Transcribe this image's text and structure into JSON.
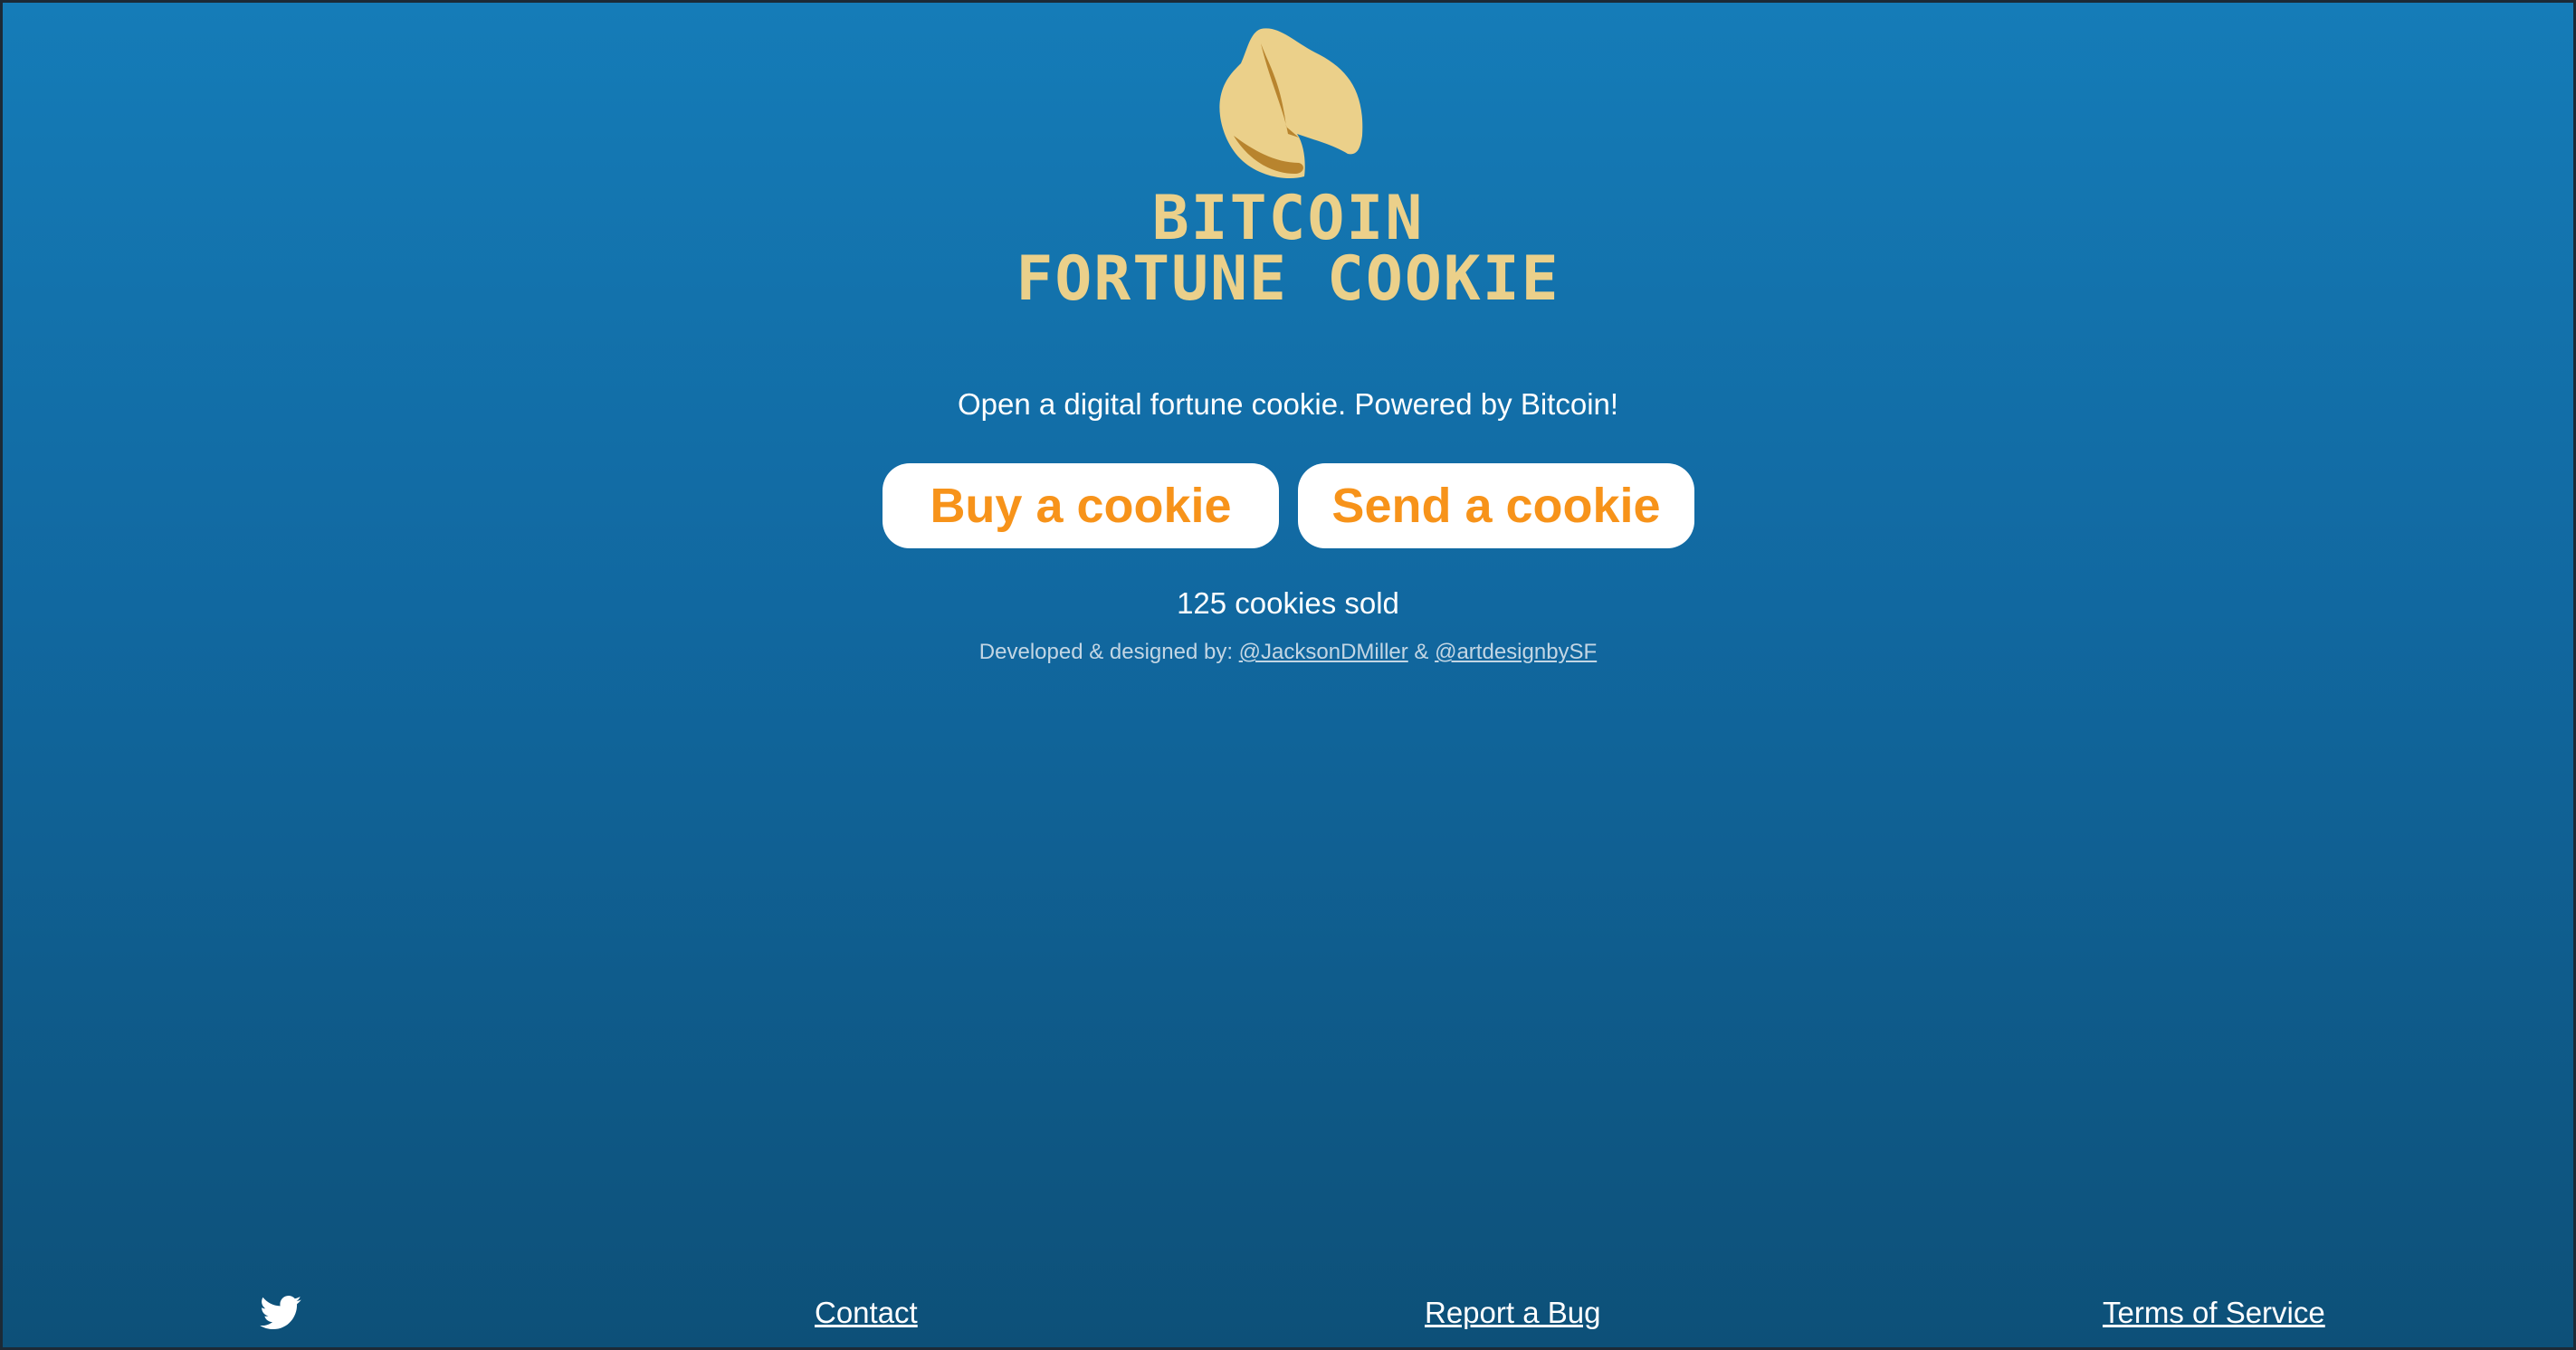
{
  "logo": {
    "line1": "Bitcoin",
    "line2": "Fortune Cookie",
    "icon": "fortune-cookie-icon"
  },
  "tagline": "Open a digital fortune cookie. Powered by Bitcoin!",
  "buttons": {
    "buy": "Buy a cookie",
    "send": "Send a cookie"
  },
  "sold": "125 cookies sold",
  "credits": {
    "prefix": "Developed & designed by: ",
    "author1": "@JacksonDMiller",
    "sep": " & ",
    "author2": "@artdesignbySF"
  },
  "footer": {
    "twitter_icon": "twitter-icon",
    "contact": "Contact",
    "report_bug": "Report a Bug",
    "terms": "Terms of Service"
  },
  "colors": {
    "accent": "#f7931a",
    "logo": "#ebd08a",
    "bg_top": "#157cb8",
    "bg_bottom": "#0d5078"
  }
}
